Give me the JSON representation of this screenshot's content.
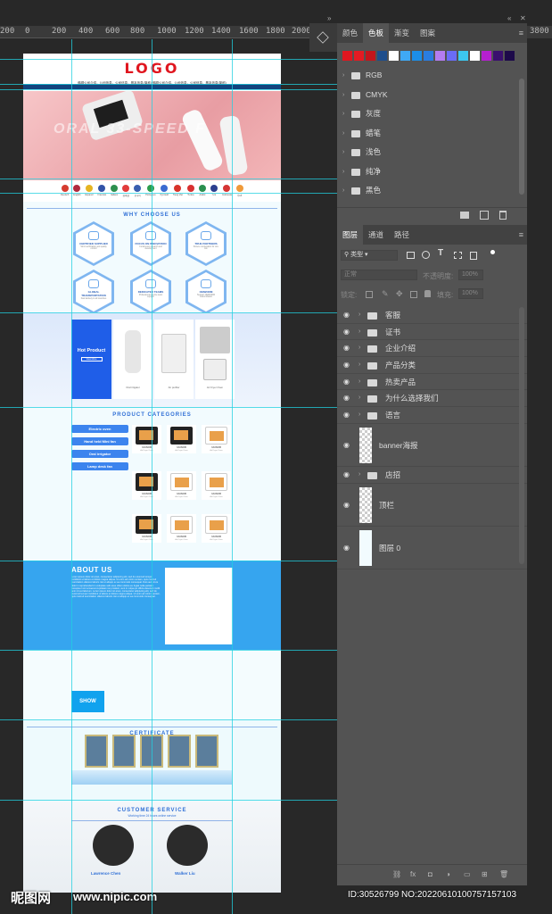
{
  "ruler": {
    "labels": [
      "200",
      "0",
      "200",
      "400",
      "600",
      "800",
      "1000",
      "1200",
      "1400",
      "1600",
      "1800",
      "2000"
    ],
    "tail": "3800"
  },
  "doc": {
    "logo": "LOGO",
    "tagline": "佛顺公司介绍，公司信息，公司信息，基本信息(简称) 佛顺公司介绍，公司信息，公司信息，基本信息(简称)",
    "banner_text": "ORAL 33-SPEED F",
    "flags": [
      {
        "label": "Deutsch",
        "color": "#d63b2f"
      },
      {
        "label": "English",
        "color": "#b02a3f"
      },
      {
        "label": "Espanol",
        "color": "#e6b422"
      },
      {
        "label": "Francais",
        "color": "#3253a8"
      },
      {
        "label": "Italiano",
        "color": "#2e8f4e"
      },
      {
        "label": "日本語",
        "color": "#e23b3b"
      },
      {
        "label": "한국어",
        "color": "#3a5fb0"
      },
      {
        "label": "Portugues",
        "color": "#2e9e4d"
      },
      {
        "label": "Русский",
        "color": "#3a6bd1"
      },
      {
        "label": "Tieng Viet",
        "color": "#d8332b"
      },
      {
        "label": "Turkce",
        "color": "#d93030"
      },
      {
        "label": "Arabic",
        "color": "#2b8f4f"
      },
      {
        "label": "ไทย",
        "color": "#2c3f8f"
      },
      {
        "label": "Indonesia",
        "color": "#d63434"
      },
      {
        "label": "हिन्दी",
        "color": "#f09a3a"
      }
    ],
    "why_title": "WHY CHOOSE US",
    "why_items": [
      {
        "title": "CERTIFIED SUPPLIER",
        "desc": "Strict certification and quality control"
      },
      {
        "title": "FOCUS ON INNOVATION",
        "desc": "Continuous research and development"
      },
      {
        "title": "TRUE PARTNERS",
        "desc": "Sincere cooperation for win-win"
      },
      {
        "title": "GLOBAL TRANSPORTATION",
        "desc": "Fast delivery to all countries"
      },
      {
        "title": "DEDICATED TEAMS",
        "desc": "Professional service team support"
      },
      {
        "title": "OEM/ODM",
        "desc": "Support OEM/ODM customization"
      }
    ],
    "hot": {
      "label": "Hot Product",
      "button": "View More",
      "products": [
        "Oral irrigator",
        "Air purifier",
        "Air Fryer Oven"
      ]
    },
    "categories_title": "PRODUCT CATEGORIES",
    "categories": [
      "Electric oven",
      "Hand held Mini fan",
      "Oral irrigator",
      "Lamp desk fan"
    ],
    "oven_label": "XAOMOB",
    "oven_sub": "Air Fryer Oven",
    "about_title": "ABOUT US",
    "about_text": "Lorem ipsum dolor sit amet, consectetur adipiscing elit, sed do eiusmod tempor incididunt ut labore et dolore magna aliqua. Ut enim ad minim veniam, quis nostrud exercitation ullamco laboris nisi ut aliquip ex ea commodo consequat. Duis aute irure dolor in reprehenderit in voluptate velit esse cillum dolore eu fugiat nulla pariatur. Excepteur sint occaecat cupidatat non proident, sunt in culpa qui officia deserunt mollit anim id est laborum. Lorem ipsum dolor sit amet, consectetur adipiscing elit, sed do eiusmod tempor incididunt ut labore et dolore magna aliqua. Ut enim ad minim veniam, quis nostrud exercitation ullamco laboris nisi ut aliquip ex ea commodo consequat.",
    "show_button": "SHOW",
    "certificate_title": "CERTIFICATE",
    "customer_title": "CUSTOMER SERVICE",
    "customer_sub": "Working time 24 hours online service",
    "agents": [
      "Lawrence Chen",
      "Walker Liu"
    ]
  },
  "color_panel": {
    "tabs": [
      "颜色",
      "色板",
      "渐变",
      "图案"
    ],
    "active_tab": "色板",
    "swatches": [
      "#e0161f",
      "#e31b23",
      "#c4151c",
      "#1f4e8c",
      "#ffffff",
      "#3fa9f5",
      "#1c8ee8",
      "#2a7de1",
      "#b47cf0",
      "#6a6cf5",
      "#3cc8f0",
      "#ffffff",
      "#b51fd0",
      "#3a0f6e",
      "#1d0a4a"
    ],
    "folders": [
      "RGB",
      "CMYK",
      "灰度",
      "蜡笔",
      "浅色",
      "纯净",
      "黑色"
    ]
  },
  "layers_panel": {
    "tabs": [
      "图层",
      "通道",
      "路径"
    ],
    "active_tab": "图层",
    "filter": "类型",
    "blend_mode": "正常",
    "opacity_label": "不透明度:",
    "opacity_value": "100%",
    "lock_label": "锁定:",
    "fill_label": "填充:",
    "fill_value": "100%",
    "groups": [
      "客服",
      "证书",
      "企业介绍",
      "产品分类",
      "热卖产品",
      "为什么选择我们",
      "语言"
    ],
    "layers": [
      {
        "name": "banner海报",
        "kind": "smart"
      },
      {
        "name": "店招",
        "kind": "group"
      },
      {
        "name": "顶栏",
        "kind": "smart"
      },
      {
        "name": "图层 0",
        "kind": "white"
      }
    ],
    "footer_icons": [
      "link-icon",
      "fx-icon",
      "mask-icon",
      "adjustment-icon",
      "folder-icon",
      "new-layer-icon",
      "trash-icon"
    ]
  },
  "watermark": {
    "logo": "昵图网",
    "url": "www.nipic.com",
    "id": "ID:30526799 NO:20220610100757157103"
  }
}
